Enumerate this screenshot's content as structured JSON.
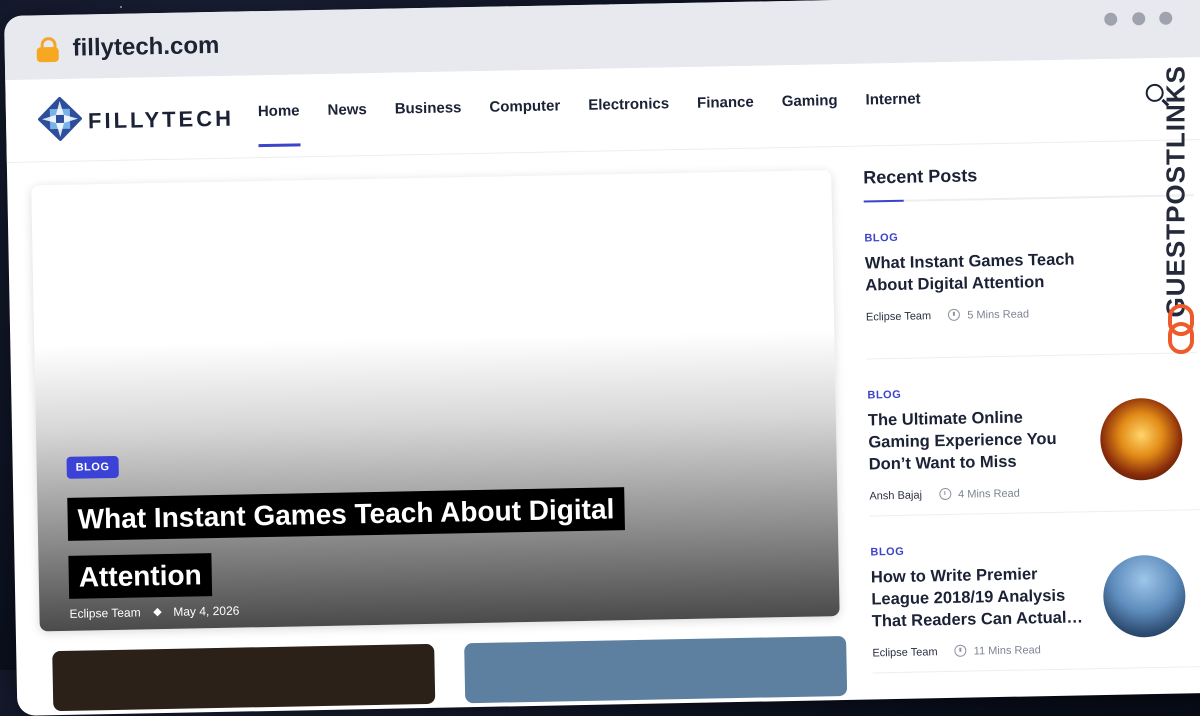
{
  "browser": {
    "url": "fillytech.com"
  },
  "site": {
    "brand": "FILLYTECH"
  },
  "nav": {
    "items": [
      "Home",
      "News",
      "Business",
      "Computer",
      "Electronics",
      "Finance",
      "Gaming",
      "Internet"
    ],
    "active": "Home"
  },
  "hero": {
    "category": "BLOG",
    "title": "What Instant Games Teach About Digital Attention",
    "author": "Eclipse Team",
    "date": "May 4, 2026"
  },
  "sidebar": {
    "title": "Recent Posts",
    "posts": [
      {
        "category": "BLOG",
        "title": "What Instant Games Teach About Digital Attention",
        "author": "Eclipse Team",
        "read_time": "5 Mins Read"
      },
      {
        "category": "BLOG",
        "title": "The Ultimate Online Gaming Experience You Don’t Want to Miss",
        "author": "Ansh Bajaj",
        "read_time": "4 Mins Read",
        "thumbnail": "slot-machine-image"
      },
      {
        "category": "BLOG",
        "title": "How to Write Premier League 2018/19 Analysis That Readers Can Actual…",
        "author": "Eclipse Team",
        "read_time": "11 Mins Read",
        "thumbnail": "football-celebration-image"
      }
    ]
  },
  "watermark": {
    "text": "GUESTPOSTLINKS"
  },
  "colors": {
    "accent": "#3c44c9",
    "badge": "#3b42d6",
    "brand_orange": "#ee5a2c"
  }
}
